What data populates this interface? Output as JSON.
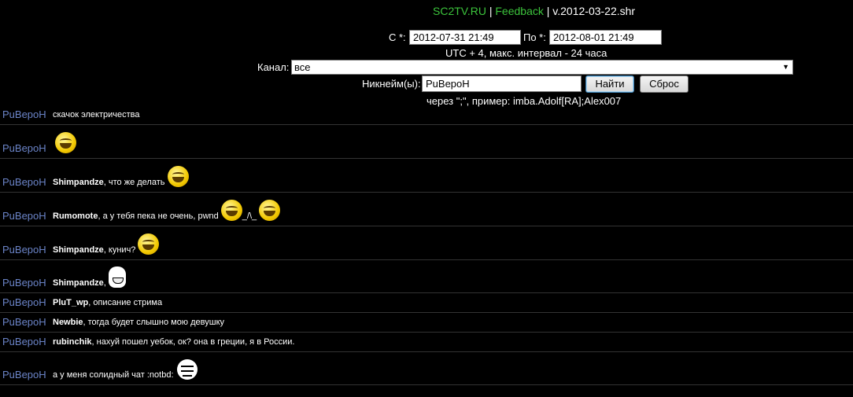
{
  "header": {
    "site_name": "SC2TV.RU",
    "separator1": "|",
    "feedback": "Feedback",
    "separator2": "|",
    "version": "v.2012-03-22.shr"
  },
  "filters": {
    "from_label": "С *:",
    "from_value": "2012-07-31 21:49",
    "to_label": "По *:",
    "to_value": "2012-08-01 21:49",
    "tz_note": "UTC + 4, макс. интервал - 24 часа",
    "channel_label": "Канал:",
    "channel_value": "все",
    "nick_label": "Никнейм(ы):",
    "nick_value": "РuВероН",
    "find_button": "Найти",
    "reset_button": "Сброс",
    "nick_hint": "через \";\", пример: imba.Adolf[RA];Alex007"
  },
  "messages": [
    {
      "nick": "РuВероН",
      "to": "",
      "text": "скачок электричества",
      "emotes": []
    },
    {
      "nick": "РuВероН",
      "to": "",
      "text": "",
      "emotes": [
        "smile"
      ]
    },
    {
      "nick": "РuВероН",
      "to": "Shimpandze",
      "text": ", что же делать",
      "emotes": [
        "smile"
      ]
    },
    {
      "nick": "РuВероН",
      "to": "Rumomote",
      "text": ", а у тебя пека не очень, pwnd",
      "emotes": [
        "smile",
        "_/\\_",
        "smile"
      ]
    },
    {
      "nick": "РuВероН",
      "to": "Shimpandze",
      "text": ", кунич?",
      "emotes": [
        "smile"
      ]
    },
    {
      "nick": "РuВероН",
      "to": "Shimpandze",
      "text": ",",
      "emotes": [
        "rage"
      ]
    },
    {
      "nick": "РuВероН",
      "to": "PluT_wp",
      "text": ", описание стрима",
      "emotes": []
    },
    {
      "nick": "РuВероН",
      "to": "Newbie",
      "text": ", тогда будет слышно мою девушку",
      "emotes": []
    },
    {
      "nick": "РuВероН",
      "to": "rubinchik",
      "text": ", нахуй пошел уебок, ок? она в греции, я в России.",
      "emotes": []
    },
    {
      "nick": "РuВероН",
      "to": "",
      "text": "а у меня солидный чат :notbd:",
      "emotes": [
        "notbd"
      ]
    }
  ]
}
